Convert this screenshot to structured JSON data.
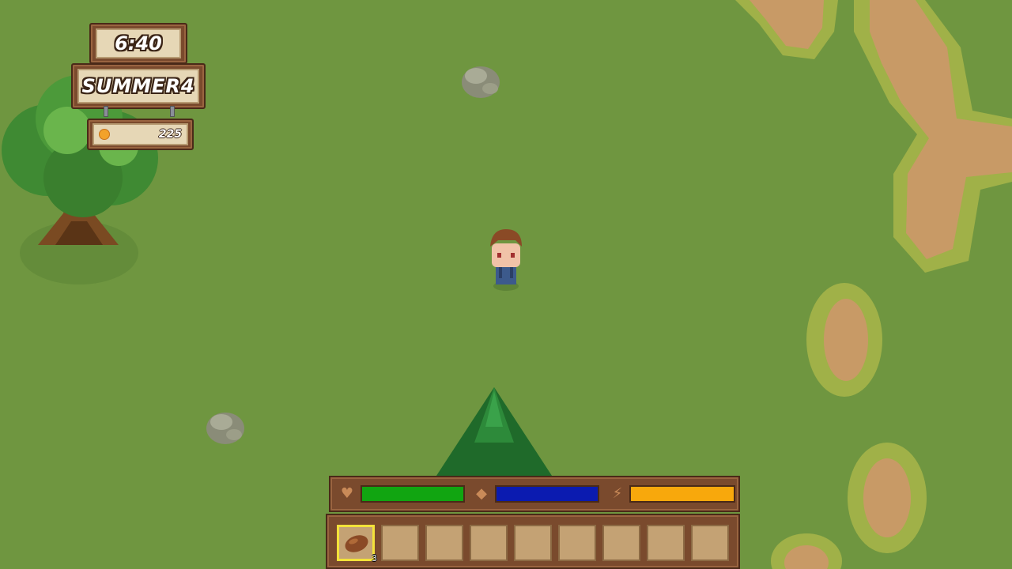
{
  "hud": {
    "time": "6:40",
    "season_day": "SUMMER4",
    "money": "225"
  },
  "stats": [
    {
      "name": "health",
      "icon": "heart-icon",
      "color": "#11a511",
      "level": 1.0
    },
    {
      "name": "hunger",
      "icon": "food-icon",
      "color": "#0b1bb0",
      "level": 1.0
    },
    {
      "name": "energy",
      "icon": "lightning-icon",
      "color": "#f8a80c",
      "level": 1.0
    }
  ],
  "hotbar": {
    "selected_index": 0,
    "slots": [
      {
        "item": "seed-icon",
        "count": "3"
      },
      {
        "item": "",
        "count": ""
      },
      {
        "item": "",
        "count": ""
      },
      {
        "item": "",
        "count": ""
      },
      {
        "item": "",
        "count": ""
      },
      {
        "item": "",
        "count": ""
      },
      {
        "item": "",
        "count": ""
      },
      {
        "item": "",
        "count": ""
      },
      {
        "item": "",
        "count": ""
      }
    ]
  },
  "colors": {
    "grass": "#6f9640",
    "dirt": "#c89a66",
    "wood": "#7a4a2d"
  }
}
